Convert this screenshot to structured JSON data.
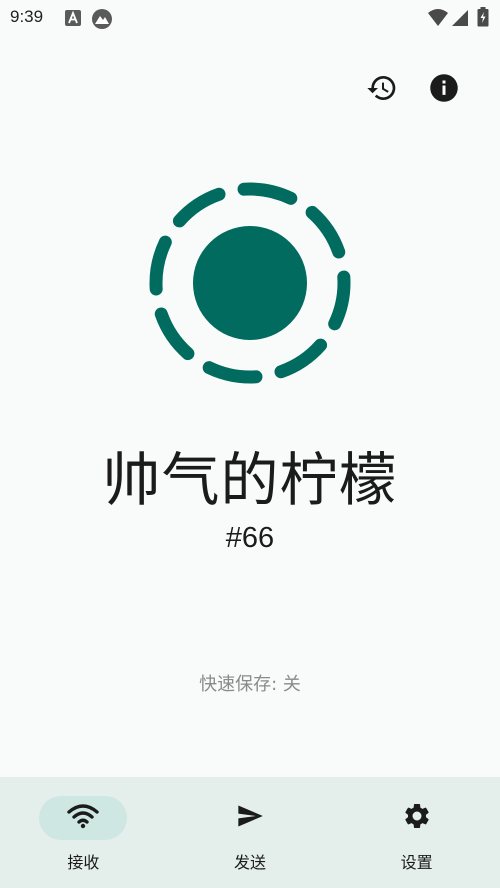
{
  "status_bar": {
    "time": "9:39",
    "icons": [
      "text-notification-icon",
      "app-notification-icon",
      "wifi-icon",
      "signal-icon",
      "battery-icon"
    ]
  },
  "header_actions": [
    {
      "icon": "history-icon"
    },
    {
      "icon": "info-icon"
    }
  ],
  "device": {
    "name": "帅气的柠檬",
    "id": "#66",
    "accent_color": "#006b5e"
  },
  "quick_save": "快速保存: 关",
  "bottom_nav": {
    "active_index": 0,
    "items": [
      {
        "label": "接收",
        "icon": "wifi-icon"
      },
      {
        "label": "发送",
        "icon": "send-icon"
      },
      {
        "label": "设置",
        "icon": "gear-icon"
      }
    ]
  },
  "colors": {
    "background": "#f8fbfa",
    "nav_background": "#e4efec",
    "active_pill": "#cfe7e2",
    "accent": "#006b5e"
  }
}
